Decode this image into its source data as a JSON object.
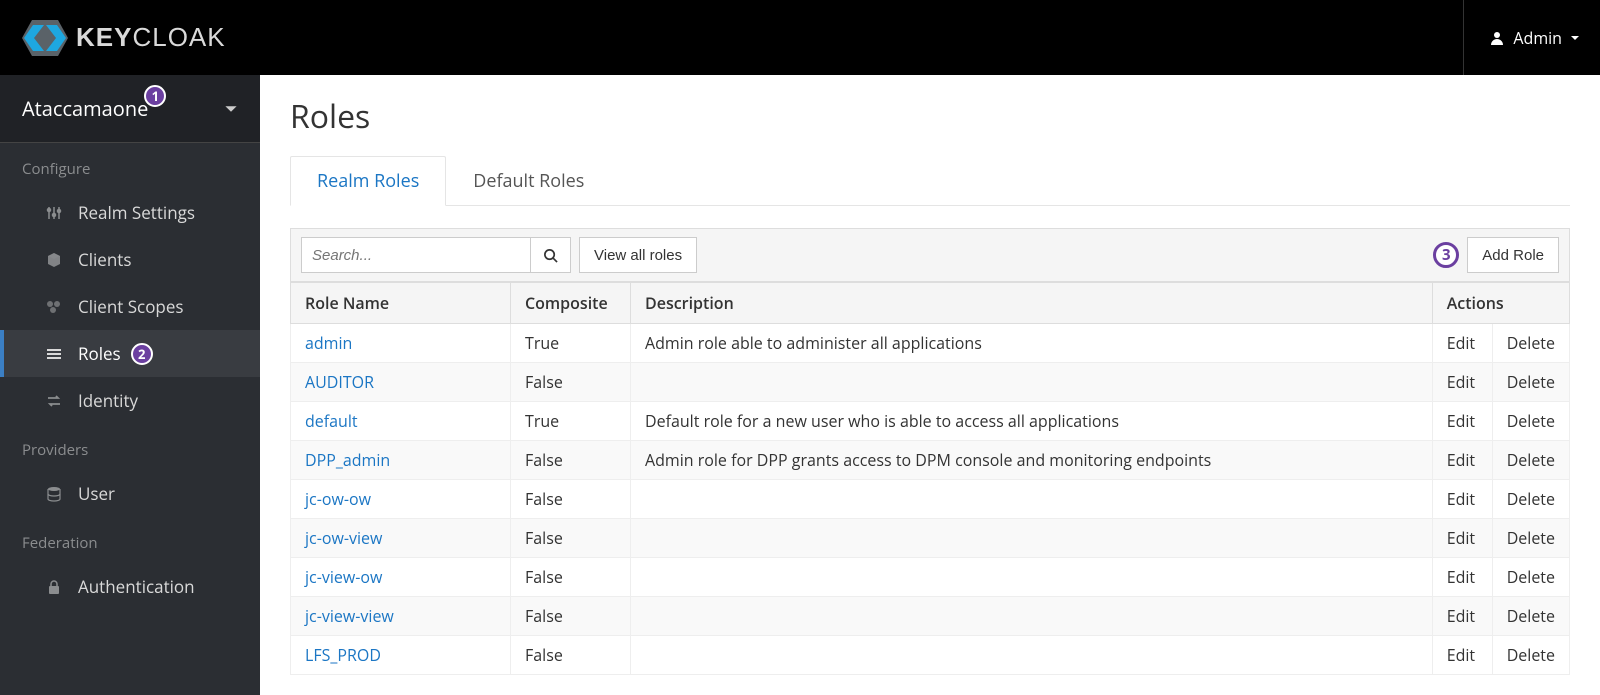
{
  "app": {
    "name_prefix": "KEY",
    "name_suffix": "CLOAK",
    "user": "Admin"
  },
  "realm": "Ataccamaone",
  "annotations": {
    "realm": "1",
    "roles": "2",
    "add_role": "3"
  },
  "sidebar": {
    "configure_label": "Configure",
    "items": [
      {
        "label": "Realm Settings"
      },
      {
        "label": "Clients"
      },
      {
        "label": "Client Scopes"
      },
      {
        "label": "Roles"
      },
      {
        "label": "Identity"
      }
    ],
    "providers_label": "Providers",
    "sub_items": [
      {
        "label": "User"
      }
    ],
    "federation_label": "Federation",
    "fed_items": [
      {
        "label": "Authentication"
      }
    ]
  },
  "page": {
    "title": "Roles"
  },
  "tabs": [
    {
      "label": "Realm Roles",
      "active": true
    },
    {
      "label": "Default Roles",
      "active": false
    }
  ],
  "toolbar": {
    "search_placeholder": "Search...",
    "view_all": "View all roles",
    "add_role": "Add Role"
  },
  "table": {
    "headers": {
      "name": "Role Name",
      "composite": "Composite",
      "description": "Description",
      "actions": "Actions"
    },
    "edit": "Edit",
    "delete": "Delete",
    "rows": [
      {
        "name": "admin",
        "composite": "True",
        "description": "Admin role able to administer all applications"
      },
      {
        "name": "AUDITOR",
        "composite": "False",
        "description": ""
      },
      {
        "name": "default",
        "composite": "True",
        "description": "Default role for a new user who is able to access all applications"
      },
      {
        "name": "DPP_admin",
        "composite": "False",
        "description": "Admin role for DPP grants access to DPM console and monitoring endpoints"
      },
      {
        "name": "jc-ow-ow",
        "composite": "False",
        "description": ""
      },
      {
        "name": "jc-ow-view",
        "composite": "False",
        "description": ""
      },
      {
        "name": "jc-view-ow",
        "composite": "False",
        "description": ""
      },
      {
        "name": "jc-view-view",
        "composite": "False",
        "description": ""
      },
      {
        "name": "LFS_PROD",
        "composite": "False",
        "description": ""
      }
    ]
  }
}
